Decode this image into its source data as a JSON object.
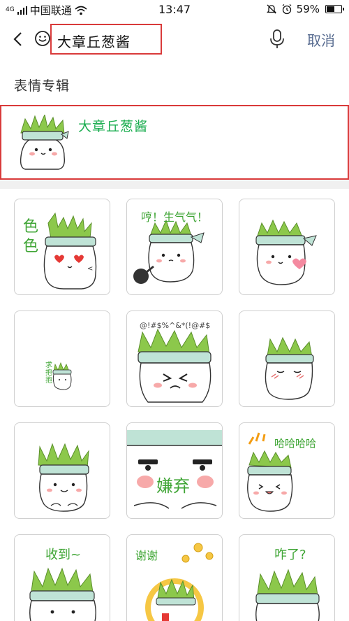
{
  "status_bar": {
    "network_tag": "4G",
    "carrier": "中国联通",
    "time": "13:47",
    "battery": "59%",
    "battery_level": 0.59
  },
  "search": {
    "query": "大章丘葱酱",
    "cancel_label": "取消"
  },
  "section": {
    "title": "表情专辑"
  },
  "album": {
    "name": "大章丘葱酱"
  },
  "stickers": [
    {
      "caption": "色\n色"
    },
    {
      "caption": "哼！生气气！"
    },
    {
      "caption": ""
    },
    {
      "caption": "求\n抱\n抱"
    },
    {
      "caption": "@!#$%^&*(!@#$"
    },
    {
      "caption": ""
    },
    {
      "caption": ""
    },
    {
      "caption": "嫌弃"
    },
    {
      "caption": "哈哈哈哈"
    },
    {
      "caption": "收到~"
    },
    {
      "caption": "谢谢"
    },
    {
      "caption": "咋了?"
    }
  ],
  "colors": {
    "accent_green": "#1aad4f",
    "highlight_red": "#d93a3a",
    "cancel_blue": "#566a8f",
    "leaf_green": "#8cc84b",
    "band_teal": "#bfe3d6"
  }
}
